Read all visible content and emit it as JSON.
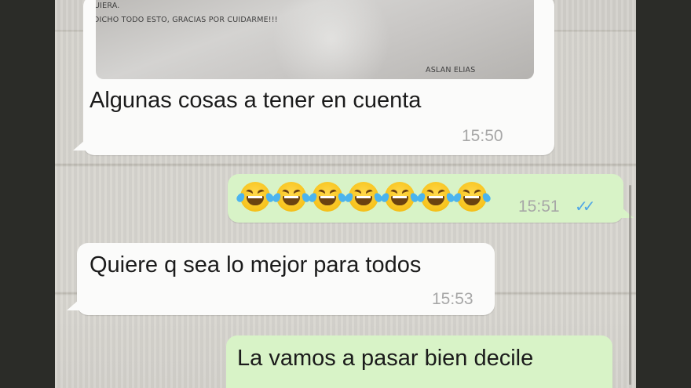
{
  "messages": [
    {
      "id": "m1",
      "direction": "incoming",
      "image_text": {
        "line1": "UIERA.",
        "line2": "DICHO TODO ESTO, GRACIAS POR CUIDARME!!!",
        "signature": "ASLAN ELIAS"
      },
      "text": "Algunas cosas a tener en cuenta",
      "time": "15:50"
    },
    {
      "id": "m2",
      "direction": "outgoing",
      "emoji": [
        "😂",
        "😂",
        "😂",
        "😂",
        "😂",
        "😂",
        "😂"
      ],
      "emoji_name": "face-with-tears-of-joy",
      "time": "15:51",
      "status": "read",
      "status_icon": "double-check-icon",
      "status_glyph": "✓✓",
      "status_color": "#4fa6e6"
    },
    {
      "id": "m3",
      "direction": "incoming",
      "text": "Quiere q sea lo mejor para todos",
      "time": "15:53"
    },
    {
      "id": "m4",
      "direction": "outgoing",
      "text": "La vamos a pasar bien decile"
    }
  ],
  "colors": {
    "incoming_bubble": "#fbfbfa",
    "outgoing_bubble": "#d8f3c7",
    "frame": "#2b2c28",
    "timestamp": "#a7a7a7"
  }
}
